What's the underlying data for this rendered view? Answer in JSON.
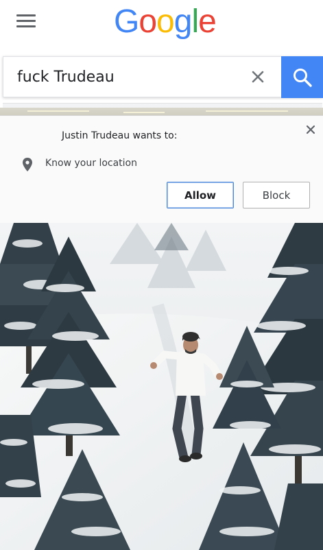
{
  "header": {
    "logo_letters": [
      {
        "char": "G",
        "color": "#4285F4"
      },
      {
        "char": "o",
        "color": "#EA4335"
      },
      {
        "char": "o",
        "color": "#FBBC05"
      },
      {
        "char": "g",
        "color": "#4285F4"
      },
      {
        "char": "l",
        "color": "#34A853"
      },
      {
        "char": "e",
        "color": "#EA4335"
      }
    ],
    "menu_icon": "hamburger-menu-icon"
  },
  "search": {
    "query": "fuck Trudeau",
    "clear_icon": "close-icon",
    "submit_icon": "magnifier-icon",
    "accent_color": "#4285F4"
  },
  "permission_prompt": {
    "title": "Justin Trudeau wants to:",
    "permission_icon": "location-pin-icon",
    "permission_text": "Know your location",
    "allow_label": "Allow",
    "block_label": "Block",
    "close_icon": "close-icon"
  },
  "photo": {
    "subject": "snowy-forest-man-running"
  }
}
